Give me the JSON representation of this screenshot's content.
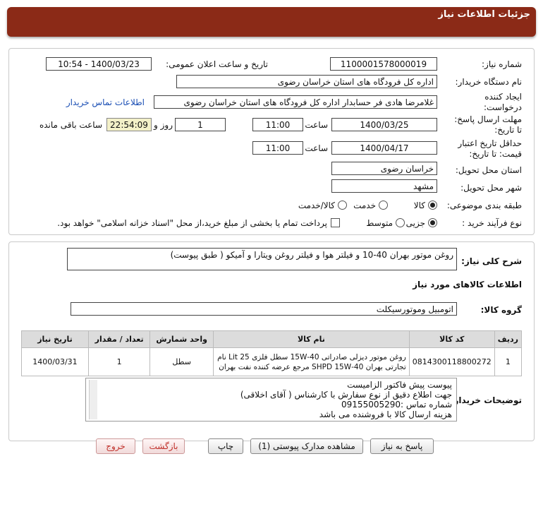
{
  "header": {
    "title": "جزئیات اطلاعات نیاز"
  },
  "form": {
    "need_number_label": "شماره نیاز:",
    "need_number": "1100001578000019",
    "announce_label": "تاریخ و ساعت اعلان عمومی:",
    "announce_value": "1400/03/23 - 10:54",
    "buyer_org_label": "نام دستگاه خریدار:",
    "buyer_org": "اداره کل فرودگاه های استان خراسان رضوی",
    "creator_label_1": "ایجاد کننده",
    "creator_label_2": "درخواست:",
    "creator": "غلامرضا هادی فر حسابدار اداره کل فرودگاه های استان خراسان رضوی",
    "contact_link": "اطلاعات تماس خریدار",
    "deadline_label_1": "مهلت ارسال پاسخ:",
    "deadline_label_2": "تا تاریخ:",
    "deadline_date": "1400/03/25",
    "time_label": "ساعت",
    "deadline_time": "11:00",
    "days_value": "1",
    "days_label": "روز و",
    "remaining_time": "22:54:09",
    "remaining_label": "ساعت باقی مانده",
    "validity_label_1": "حداقل تاریخ اعتبار",
    "validity_label_2": "قیمت: تا تاریخ:",
    "validity_date": "1400/04/17",
    "validity_time_label": "ساعت",
    "validity_time": "11:00",
    "province_label": "استان محل تحویل:",
    "province": "خراسان رضوی",
    "city_label": "شهر محل تحویل:",
    "city": "مشهد",
    "category_label": "طبقه بندی موضوعی:",
    "category_options": [
      "کالا",
      "خدمت",
      "کالا/خدمت"
    ],
    "process_label": "نوع فرآیند خرید :",
    "process_options": [
      "جزیی",
      "متوسط"
    ],
    "payment_note": "پرداخت تمام یا بخشی از مبلغ خرید،از محل \"اسناد خزانه اسلامی\" خواهد بود."
  },
  "summary": {
    "label": "شرح کلی نیاز:",
    "text": "روغن موتور بهران 40-10 و فیلتر هوا و فیلتر روغن  ویتارا و آمیکو ( طبق پیوست)"
  },
  "goods": {
    "section_title": "اطلاعات کالاهای مورد نیاز",
    "group_label": "گروه کالا:",
    "group_value": "اتومبیل وموتورسیکلت",
    "columns": [
      "ردیف",
      "کد کالا",
      "نام کالا",
      "واحد شمارش",
      "تعداد / مقدار",
      "تاریخ نیاز"
    ],
    "rows": [
      {
        "index": "1",
        "code": "0814300118800272",
        "name_line1": "روغن موتور دیزلی صادراتی 40-15W سطل فلزی 25 Lit نام",
        "name_line2": "تجارتی بهران 40-SHPD 15W مرجع عرضه کننده نفت بهران",
        "unit": "سطل",
        "qty": "1",
        "date": "1400/03/31"
      }
    ]
  },
  "buyer_notes": {
    "label": "توضیحات خریدار:",
    "lines": [
      "پیوست پیش فاکتور الزامیست",
      "جهت اطلاع دقیق از نوع سفارش با کارشناس  ( آقای اخلاقی)",
      "شماره تماس :09155005290",
      "هزینه ارسال کالا با فروشنده می باشد"
    ]
  },
  "buttons": {
    "reply": "پاسخ به نیاز",
    "attachments": "مشاهده مدارک پیوستی (1)",
    "print": "چاپ",
    "back": "بازگشت",
    "exit": "خروج"
  },
  "colors": {
    "header_bg": "#8b2a17",
    "remaining_bg": "#f3f0c8",
    "link": "#1b4fb4"
  }
}
